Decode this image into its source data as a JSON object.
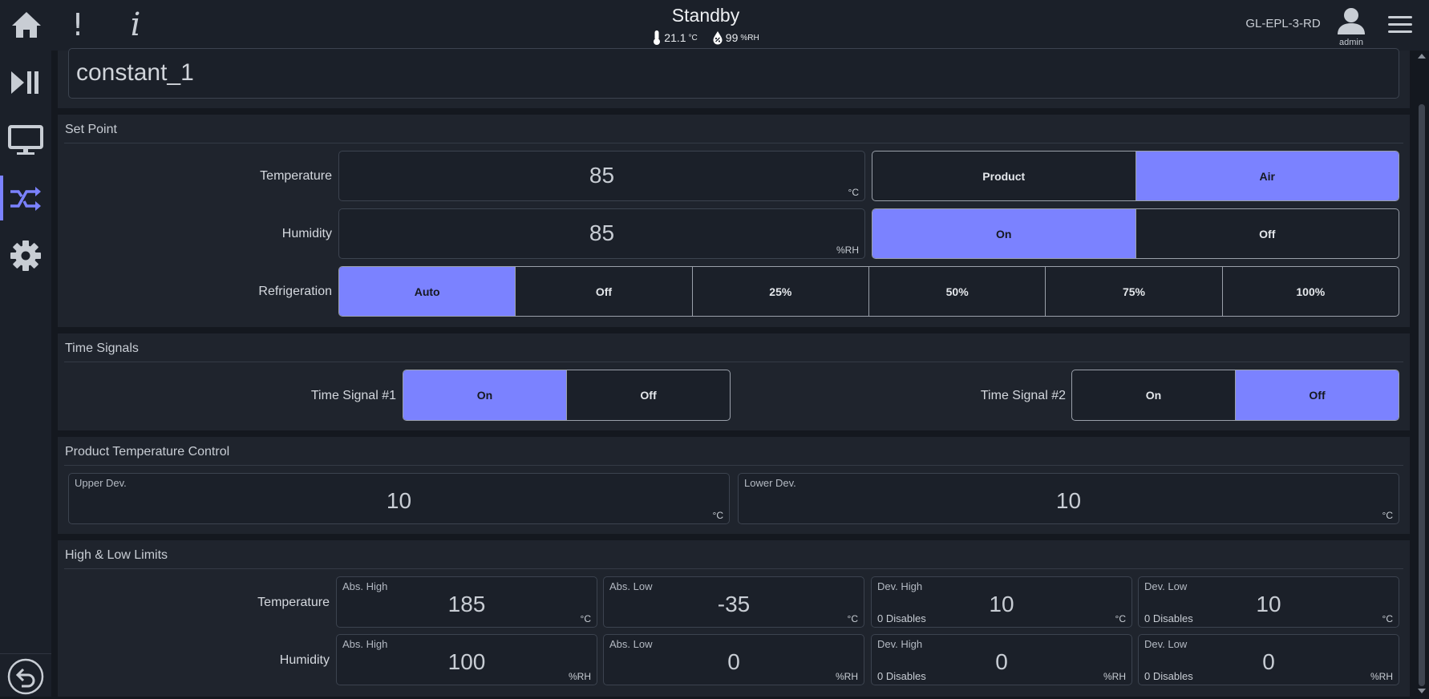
{
  "header": {
    "status": "Standby",
    "temperature": "21.1",
    "temperature_unit": "°C",
    "humidity": "99",
    "humidity_unit": "%RH",
    "device_name": "GL-EPL-3-RD",
    "user": "admin"
  },
  "profile": {
    "name": "constant_1"
  },
  "set_point": {
    "title": "Set Point",
    "temperature": {
      "label": "Temperature",
      "value": "85",
      "unit": "°C",
      "options": [
        "Product",
        "Air"
      ],
      "selected": "Air"
    },
    "humidity": {
      "label": "Humidity",
      "value": "85",
      "unit": "%RH",
      "options": [
        "On",
        "Off"
      ],
      "selected": "On"
    },
    "refrigeration": {
      "label": "Refrigeration",
      "options": [
        "Auto",
        "Off",
        "25%",
        "50%",
        "75%",
        "100%"
      ],
      "selected": "Auto"
    }
  },
  "time_signals": {
    "title": "Time Signals",
    "signal1": {
      "label": "Time Signal #1",
      "options": [
        "On",
        "Off"
      ],
      "selected": "On"
    },
    "signal2": {
      "label": "Time Signal #2",
      "options": [
        "On",
        "Off"
      ],
      "selected": "Off"
    }
  },
  "product_temp_control": {
    "title": "Product Temperature Control",
    "upper": {
      "caption": "Upper Dev.",
      "value": "10",
      "unit": "°C"
    },
    "lower": {
      "caption": "Lower Dev.",
      "value": "10",
      "unit": "°C"
    }
  },
  "limits": {
    "title": "High & Low Limits",
    "temperature": {
      "label": "Temperature",
      "abs_high": {
        "caption": "Abs. High",
        "value": "185",
        "unit": "°C"
      },
      "abs_low": {
        "caption": "Abs. Low",
        "value": "-35",
        "unit": "°C"
      },
      "dev_high": {
        "caption": "Dev. High",
        "value": "10",
        "unit": "°C",
        "note": "0 Disables"
      },
      "dev_low": {
        "caption": "Dev. Low",
        "value": "10",
        "unit": "°C",
        "note": "0 Disables"
      }
    },
    "humidity": {
      "label": "Humidity",
      "abs_high": {
        "caption": "Abs. High",
        "value": "100",
        "unit": "%RH"
      },
      "abs_low": {
        "caption": "Abs. Low",
        "value": "0",
        "unit": "%RH"
      },
      "dev_high": {
        "caption": "Dev. High",
        "value": "0",
        "unit": "%RH",
        "note": "0 Disables"
      },
      "dev_low": {
        "caption": "Dev. Low",
        "value": "0",
        "unit": "%RH",
        "note": "0 Disables"
      }
    }
  },
  "icons": {
    "top": [
      "home-icon",
      "alert-icon",
      "info-icon"
    ],
    "sidebar": [
      "play-pause-icon",
      "monitor-icon",
      "program-icon",
      "gear-icon"
    ],
    "bottom": "back-icon"
  },
  "colors": {
    "accent": "#7b82ff",
    "background": "#14181f",
    "panel": "#1f242d"
  }
}
